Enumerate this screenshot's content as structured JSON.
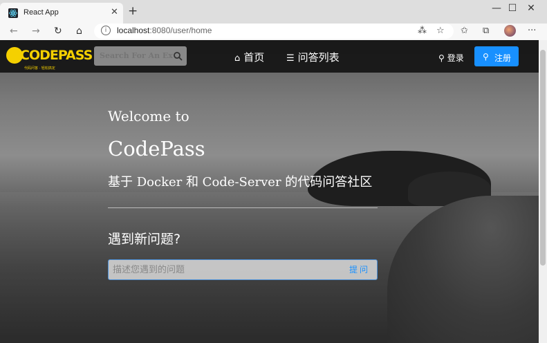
{
  "browser": {
    "tab_title": "React App",
    "tab_close": "✕",
    "new_tab": "+",
    "url_host": "localhost",
    "url_rest": ":8080/user/home",
    "controls": {
      "minimize": "—",
      "maximize": "☐",
      "close": "✕"
    },
    "more": "···"
  },
  "header": {
    "logo_text": "CODEPASS",
    "logo_sub": "代码问答 · 轻松搞定",
    "search_placeholder": "Search For An Exist...",
    "nav": [
      {
        "label": "首页",
        "icon": "home-icon"
      },
      {
        "label": "问答列表",
        "icon": "list-icon"
      }
    ],
    "login_label": "登录",
    "register_label": "注册"
  },
  "hero": {
    "welcome": "Welcome to",
    "brand": "CodePass",
    "tagline": "基于 Docker 和 Code-Server 的代码问答社区",
    "question_title": "遇到新问题?",
    "ask_placeholder": "描述您遇到的问题",
    "ask_button": "提问"
  },
  "colors": {
    "accent": "#1890ff",
    "logo": "#f5d000",
    "header_bg": "#141414"
  }
}
